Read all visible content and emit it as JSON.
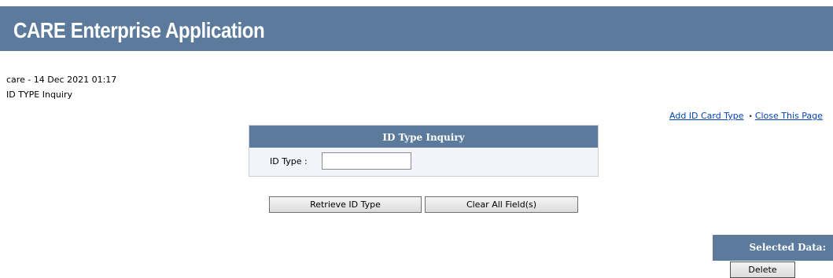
{
  "app": {
    "title": "CARE Enterprise Application"
  },
  "session": {
    "info": "care - 14 Dec 2021 01:17",
    "page_name": "ID TYPE Inquiry"
  },
  "links": {
    "add_id_card_type": "Add ID Card Type",
    "separator": "•",
    "close_page": "Close This Page"
  },
  "inquiry_panel": {
    "title": "ID Type Inquiry",
    "id_type_label": "ID Type :",
    "id_type_value": "",
    "id_type_placeholder": ""
  },
  "buttons": {
    "retrieve": "Retrieve ID Type",
    "clear": "Clear All Field(s)",
    "delete": "Delete"
  },
  "selected_data": {
    "title": "Selected Data:"
  },
  "colors": {
    "header_bg": "#5b7a9c",
    "panel_bg": "#f2f3fb",
    "link": "#0044bb"
  }
}
